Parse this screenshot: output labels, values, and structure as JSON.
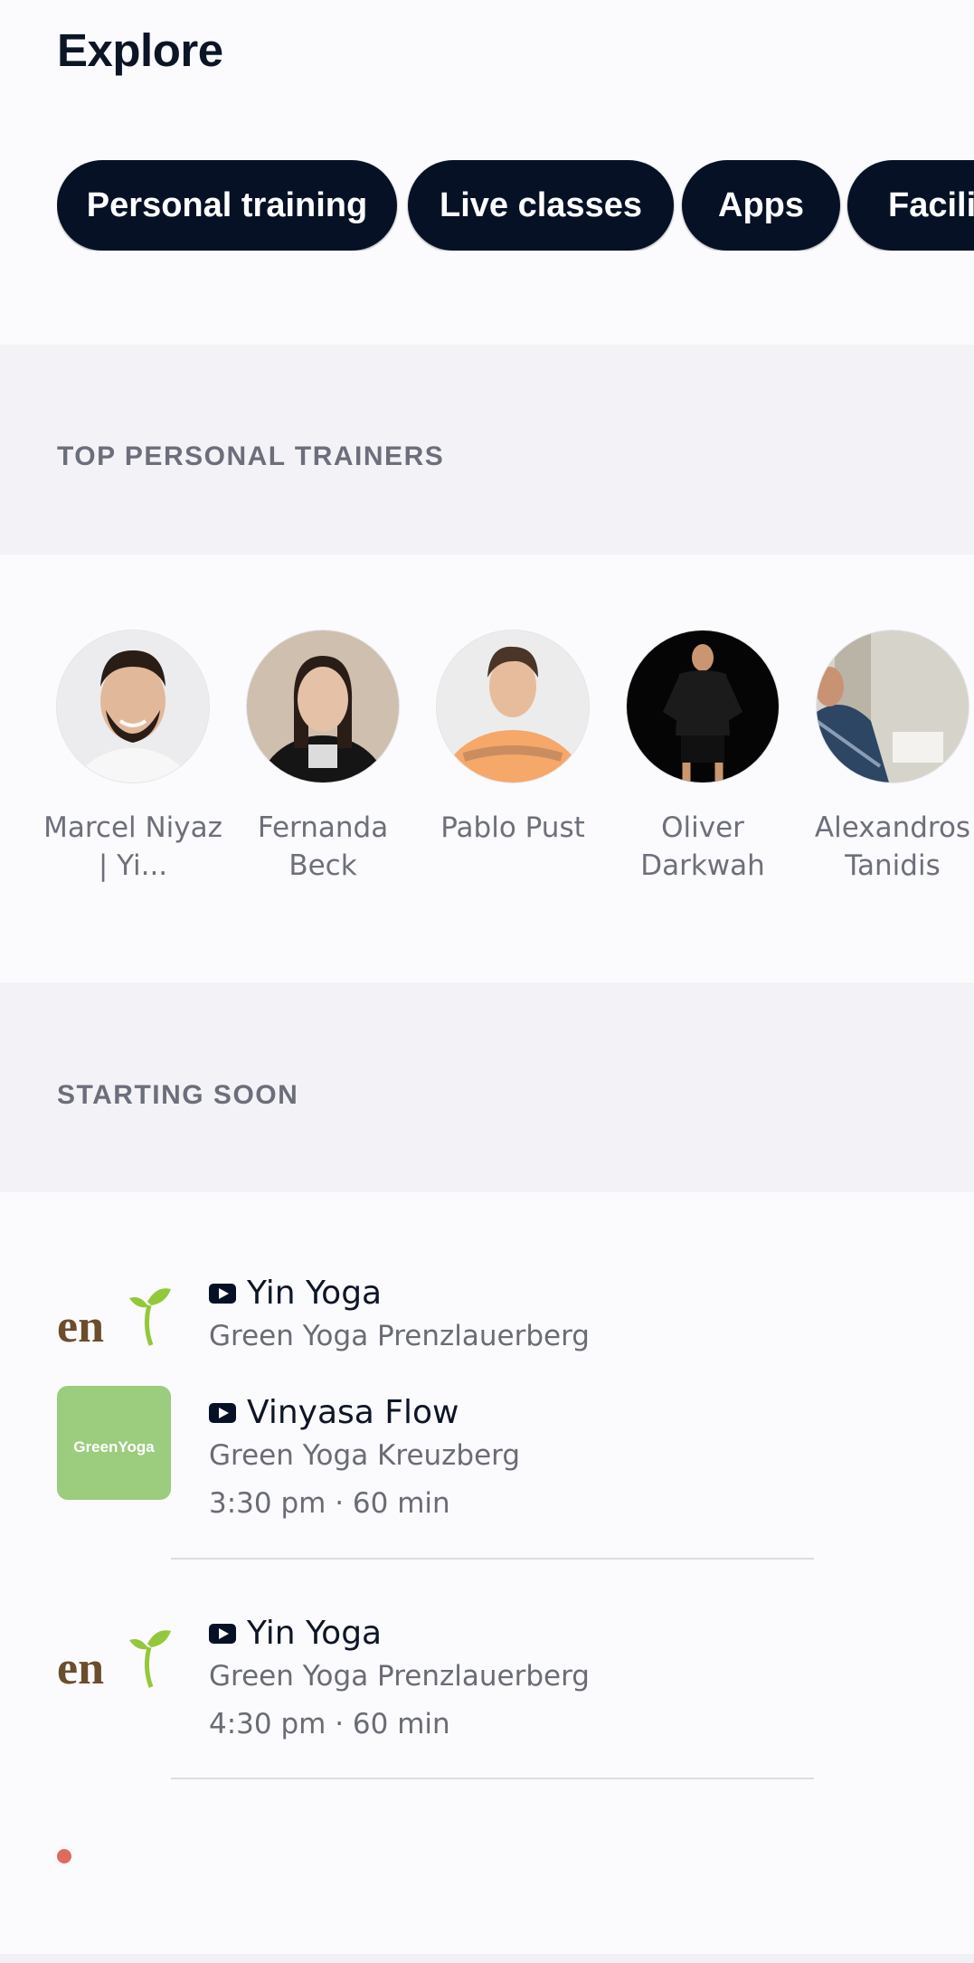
{
  "header": {
    "title": "Explore"
  },
  "chips": [
    "Personal training",
    "Live classes",
    "Apps",
    "Facilit"
  ],
  "sections": {
    "trainers_title": "TOP PERSONAL TRAINERS",
    "starting_soon_title": "STARTING SOON"
  },
  "trainers": [
    {
      "name": "Marcel Niyaz | Yi..."
    },
    {
      "name": "Fernanda Beck"
    },
    {
      "name": "Pablo Pust"
    },
    {
      "name": "Oliver Darkwah"
    },
    {
      "name": "Alexandros Tanidis"
    }
  ],
  "classes": [
    {
      "title": "Yin Yoga",
      "studio": "Green Yoga Prenzlauerberg",
      "time": "",
      "logo_text": "en"
    },
    {
      "title": "Vinyasa Flow",
      "studio": "Green Yoga Kreuzberg",
      "time": "3:30 pm · 60 min",
      "logo_text": "GreenYoga"
    },
    {
      "title": "Yin Yoga",
      "studio": "Green Yoga Prenzlauerberg",
      "time": "4:30 pm · 60 min",
      "logo_text": "en"
    }
  ],
  "icons": {
    "class_type": "video-play-icon"
  },
  "colors": {
    "chip_bg": "#061126",
    "band_bg": "#f3f3f7",
    "logo_green": "#9ccc7e",
    "indicator": "#e06a5f"
  }
}
